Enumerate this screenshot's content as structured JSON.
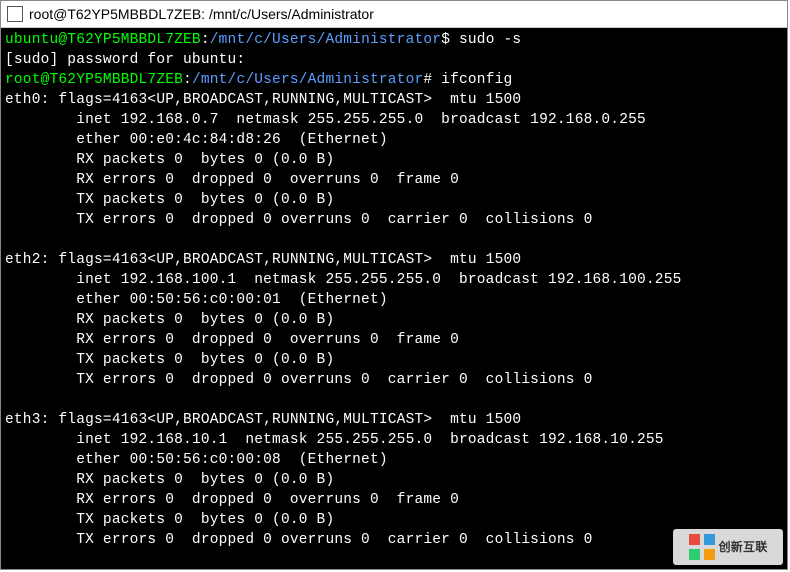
{
  "window": {
    "title": "root@T62YP5MBBDL7ZEB: /mnt/c/Users/Administrator"
  },
  "prompt1": {
    "user_host": "ubuntu@T62YP5MBBDL7ZEB",
    "sep": ":",
    "path": "/mnt/c/Users/Administrator",
    "suffix": "$",
    "cmd": " sudo -s"
  },
  "sudo_line": "[sudo] password for ubuntu:",
  "prompt2": {
    "user_host": "root@T62YP5MBBDL7ZEB",
    "sep": ":",
    "path": "/mnt/c/Users/Administrator",
    "suffix": "#",
    "cmd": " ifconfig"
  },
  "eth0": {
    "l1": "eth0: flags=4163<UP,BROADCAST,RUNNING,MULTICAST>  mtu 1500",
    "l2": "        inet 192.168.0.7  netmask 255.255.255.0  broadcast 192.168.0.255",
    "l3": "        ether 00:e0:4c:84:d8:26  (Ethernet)",
    "l4": "        RX packets 0  bytes 0 (0.0 B)",
    "l5": "        RX errors 0  dropped 0  overruns 0  frame 0",
    "l6": "        TX packets 0  bytes 0 (0.0 B)",
    "l7": "        TX errors 0  dropped 0 overruns 0  carrier 0  collisions 0"
  },
  "eth2": {
    "l1": "eth2: flags=4163<UP,BROADCAST,RUNNING,MULTICAST>  mtu 1500",
    "l2": "        inet 192.168.100.1  netmask 255.255.255.0  broadcast 192.168.100.255",
    "l3": "        ether 00:50:56:c0:00:01  (Ethernet)",
    "l4": "        RX packets 0  bytes 0 (0.0 B)",
    "l5": "        RX errors 0  dropped 0  overruns 0  frame 0",
    "l6": "        TX packets 0  bytes 0 (0.0 B)",
    "l7": "        TX errors 0  dropped 0 overruns 0  carrier 0  collisions 0"
  },
  "eth3": {
    "l1": "eth3: flags=4163<UP,BROADCAST,RUNNING,MULTICAST>  mtu 1500",
    "l2": "        inet 192.168.10.1  netmask 255.255.255.0  broadcast 192.168.10.255",
    "l3": "        ether 00:50:56:c0:00:08  (Ethernet)",
    "l4": "        RX packets 0  bytes 0 (0.0 B)",
    "l5": "        RX errors 0  dropped 0  overruns 0  frame 0",
    "l6": "        TX packets 0  bytes 0 (0.0 B)",
    "l7": "        TX errors 0  dropped 0 overruns 0  carrier 0  collisions 0"
  },
  "watermark": {
    "text": "创新互联"
  }
}
